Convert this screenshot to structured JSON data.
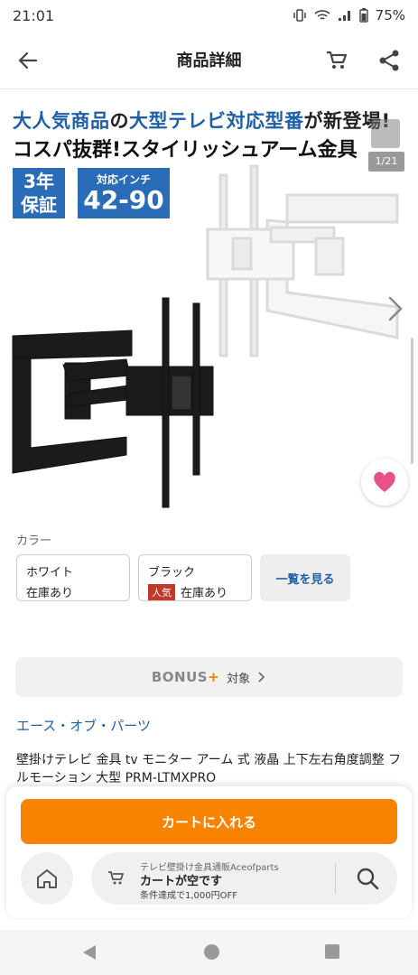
{
  "status": {
    "time": "21:01",
    "battery": "75%"
  },
  "header": {
    "title": "商品詳細"
  },
  "hero": {
    "line1_a": "大人気商品",
    "line1_b": "の",
    "line1_c": "大型テレビ対応型番",
    "line1_d": "が新登場!",
    "line2": "コスパ抜群!スタイリッシュアーム金具",
    "badge_warranty_1": "3年",
    "badge_warranty_2": "保証",
    "badge_size_label": "対応インチ",
    "badge_size_value": "42-90",
    "image_counter": "1/21"
  },
  "colors": {
    "label": "カラー",
    "options": [
      {
        "name": "ホワイト",
        "stock": "在庫あり"
      },
      {
        "name": "ブラック",
        "tag": "人気",
        "stock": "在庫あり"
      }
    ],
    "view_all": "一覧を見る"
  },
  "bonus": {
    "logo": "BONUS",
    "plus": "+",
    "text": "対象"
  },
  "shop_name": "エース・オブ・パーツ",
  "product_name": "壁掛けテレビ 金具 tv モニター アーム 式 液晶 上下左右角度調整 フルモーション 大型 PRM-LTMXPRO",
  "bottom": {
    "add_to_cart": "カートに入れる",
    "cart_shop": "テレビ壁掛け金具通販Aceofparts",
    "cart_empty": "カートが空です",
    "cart_condition": "条件達成で1,000円OFF"
  },
  "colors_theme": {
    "accent": "#f88300",
    "brand_blue": "#1f5fa8",
    "fav_pink": "#e8508a"
  }
}
